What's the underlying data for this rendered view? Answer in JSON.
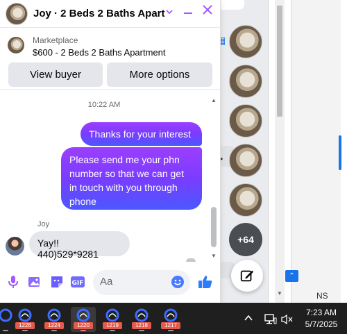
{
  "chat": {
    "title": "Joy · 2 Beds 2 Baths Apart··",
    "marketplace_label": "Marketplace",
    "item": "$600 - 2 Beds 2 Baths Apartment",
    "view_buyer": "View buyer",
    "more_options": "More options",
    "time": "10:22 AM",
    "outgoing": [
      "Thanks for your interest",
      "Please send me your phn number so that we can get in touch with you through phone"
    ],
    "sender_name": "Joy",
    "incoming": "Yay!! 440)529*9281",
    "input_placeholder": "Aa"
  },
  "chat_heads": {
    "more_count": "+64"
  },
  "background": {
    "ns_text": "NS"
  },
  "taskbar": {
    "apps": [
      "1226",
      "1224",
      "1220",
      "1219",
      "1218",
      "1217"
    ],
    "active_app": "1220",
    "time": "7:23 AM",
    "date": "5/7/2025"
  },
  "colors": {
    "accent": "#a259ff",
    "bubble_top": "#9b3fff",
    "bubble_bottom": "#4a58ff",
    "like_blue": "#0084ff"
  }
}
